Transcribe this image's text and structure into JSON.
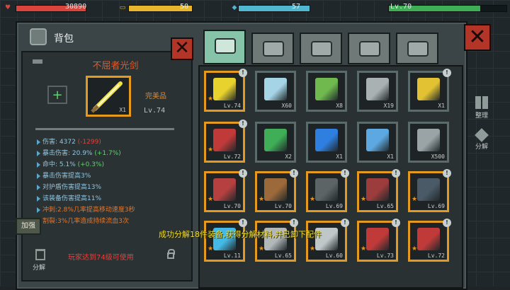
{
  "hud": {
    "hp": {
      "value": "30890",
      "fill": 1.0,
      "color": "#d9453d"
    },
    "energy": {
      "value": "50",
      "fill": 1.0,
      "color": "#e8b62d"
    },
    "mana": {
      "value": "57",
      "fill": 1.0,
      "color": "#4fb8d0"
    },
    "level": {
      "value": "Lv.70",
      "fill": 0.78,
      "color": "#3fae57"
    }
  },
  "inventory": {
    "title": "背包",
    "selected_item": {
      "name": "不屈者光剑",
      "quality": "完美品",
      "level": "Lv.74",
      "count": "X1"
    },
    "stats": [
      {
        "label": "伤害: 4372",
        "delta": "(-1299)",
        "delta_color": "red"
      },
      {
        "label": "暴击伤害: 20.9%",
        "delta": "(+1.7%)",
        "delta_color": "green"
      },
      {
        "label": "命中: 5.1%",
        "delta": "(+0.3%)",
        "delta_color": "green"
      },
      {
        "label": "暴击伤害提高3%",
        "delta": "",
        "delta_color": ""
      },
      {
        "label": "对护盾伤害提高13%",
        "delta": "",
        "delta_color": ""
      },
      {
        "label": "该装备伤害提高11%",
        "delta": "",
        "delta_color": ""
      },
      {
        "label": "冲刺:2.8%几率提高移动速度3秒",
        "delta": "",
        "delta_color": "",
        "color": "orange"
      },
      {
        "label": "割裂:3%几率造成持续流血3次",
        "delta": "",
        "delta_color": "",
        "color": "orange"
      }
    ],
    "strengthen_label": "加强",
    "dismantle_label": "分解",
    "requirement": "玩家达到74级可使用",
    "tabs": [
      "backpack-tab",
      "medkit-tab",
      "armor-tab",
      "gun-tab",
      "misc-tab"
    ],
    "side": {
      "sort_label": "整理",
      "dismantle_label": "分解"
    },
    "message": "成功分解18件装备,获得分解材料,并已卸下配件",
    "items": [
      {
        "name": "light-saber",
        "label": "Lv.74",
        "color": "#e8d22d",
        "border": "#e39a1f",
        "badge": "!"
      },
      {
        "name": "potion-flask",
        "label": "X60",
        "color": "#a5d4e6",
        "border": "#5b6a6a",
        "badge": ""
      },
      {
        "name": "green-machine",
        "label": "X8",
        "color": "#6fb94e",
        "border": "#5b6a6a",
        "badge": ""
      },
      {
        "name": "steel-cube",
        "label": "X19",
        "color": "#a9b1b3",
        "border": "#5b6a6a",
        "badge": ""
      },
      {
        "name": "gold-emblem",
        "label": "X1",
        "color": "#e2c233",
        "border": "#5b6a6a",
        "badge": "!"
      },
      {
        "name": "red-boots",
        "label": "Lv.72",
        "color": "#c13a3a",
        "border": "#e39a1f",
        "badge": "!"
      },
      {
        "name": "sale-card",
        "label": "X2",
        "color": "#3fae57",
        "border": "#5b6a6a",
        "badge": ""
      },
      {
        "name": "music-disc",
        "label": "X1",
        "color": "#2f7fe1",
        "border": "#5b6a6a",
        "badge": ""
      },
      {
        "name": "robot-chip",
        "label": "X1",
        "color": "#5da8e0",
        "border": "#5b6a6a",
        "badge": ""
      },
      {
        "name": "exp-badge",
        "label": "X500",
        "color": "#9aa4a6",
        "border": "#5b6a6a",
        "badge": ""
      },
      {
        "name": "blood-sword",
        "label": "Lv.70",
        "color": "#b64040",
        "border": "#e39a1f",
        "badge": "!"
      },
      {
        "name": "shotgun",
        "label": "Lv.70",
        "color": "#9c6a3a",
        "border": "#e39a1f",
        "badge": "!"
      },
      {
        "name": "crossbow",
        "label": "Lv.69",
        "color": "#5d6466",
        "border": "#e39a1f",
        "badge": "!"
      },
      {
        "name": "blood-blade",
        "label": "Lv.65",
        "color": "#9c3c3c",
        "border": "#e39a1f",
        "badge": "!"
      },
      {
        "name": "blue-crossbow",
        "label": "Lv.69",
        "color": "#4a5a66",
        "border": "#e39a1f",
        "badge": "!"
      },
      {
        "name": "blue-saber",
        "label": "Lv.11",
        "color": "#45b9e6",
        "border": "#e39a1f",
        "badge": "!"
      },
      {
        "name": "curved-blade",
        "label": "Lv.65",
        "color": "#b2b8ba",
        "border": "#e39a1f",
        "badge": "!"
      },
      {
        "name": "battle-axe",
        "label": "Lv.60",
        "color": "#c0c7c8",
        "border": "#e39a1f",
        "badge": "!"
      },
      {
        "name": "red-armor",
        "label": "Lv.73",
        "color": "#c13a3a",
        "border": "#e39a1f",
        "badge": "!"
      },
      {
        "name": "red-boots-2",
        "label": "Lv.72",
        "color": "#c13a3a",
        "border": "#e39a1f",
        "badge": "!"
      }
    ]
  }
}
